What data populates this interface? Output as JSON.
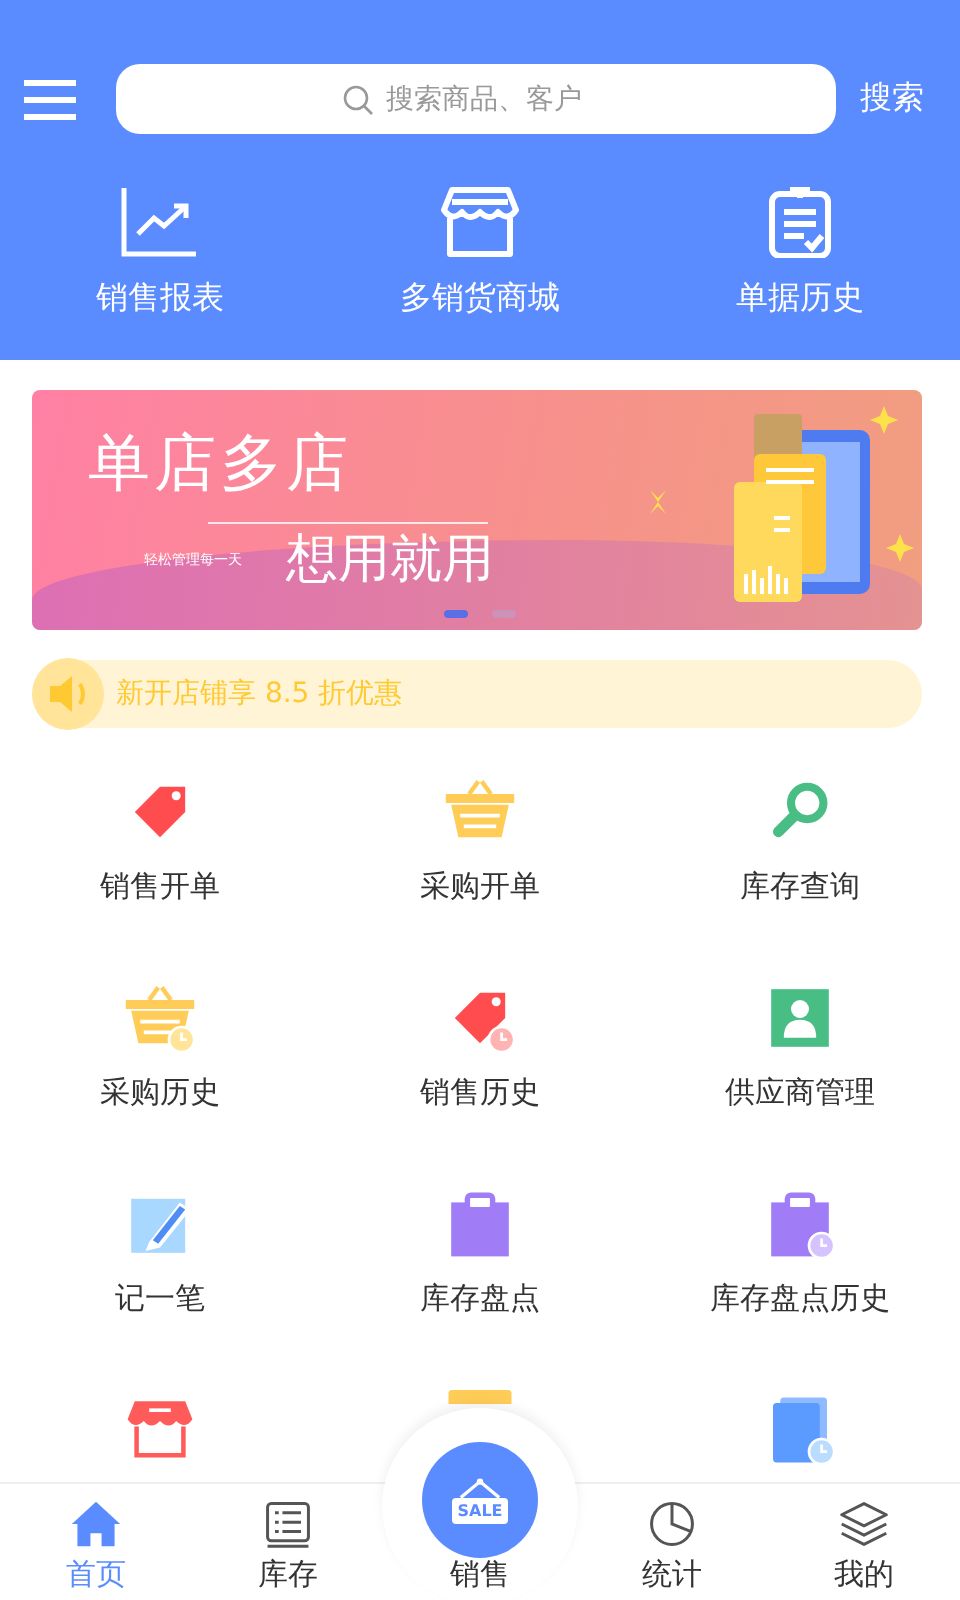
{
  "header": {
    "search": {
      "placeholder": "搜索商品、客户"
    },
    "search_button": "搜索"
  },
  "quick_links": [
    {
      "kind": "chart",
      "label": "销售报表"
    },
    {
      "kind": "store",
      "label": "多销货商城"
    },
    {
      "kind": "clipboard",
      "label": "单据历史"
    }
  ],
  "banner": {
    "title": "单店多店",
    "tagline": "轻松管理每一天",
    "slogan": "想用就用",
    "dots": [
      {
        "selected": true
      },
      {
        "selected": false
      }
    ]
  },
  "notice": {
    "text": "新开店铺享 8.5 折优惠"
  },
  "grid": [
    {
      "kind": "tag",
      "label": "销售开单"
    },
    {
      "kind": "basket",
      "label": "采购开单"
    },
    {
      "kind": "search",
      "label": "库存查询"
    },
    {
      "kind": "basket-clock",
      "label": "采购历史"
    },
    {
      "kind": "tag-clock",
      "label": "销售历史"
    },
    {
      "kind": "contact",
      "label": "供应商管理"
    },
    {
      "kind": "pencil",
      "label": "记一笔"
    },
    {
      "kind": "clipboard",
      "label": "库存盘点"
    },
    {
      "kind": "clipboard-clock",
      "label": "库存盘点历史"
    },
    {
      "kind": "store"
    },
    {
      "kind": "box"
    },
    {
      "kind": "docs-clock"
    }
  ],
  "tab_bar": [
    {
      "kind": "home",
      "label": "首页",
      "selected": true
    },
    {
      "kind": "list",
      "label": "库存",
      "selected": false
    },
    {
      "kind": "sale",
      "label": "销售",
      "badge": "SALE",
      "selected": false
    },
    {
      "kind": "pie",
      "label": "统计",
      "selected": false
    },
    {
      "kind": "layers",
      "label": "我的",
      "selected": false
    }
  ]
}
